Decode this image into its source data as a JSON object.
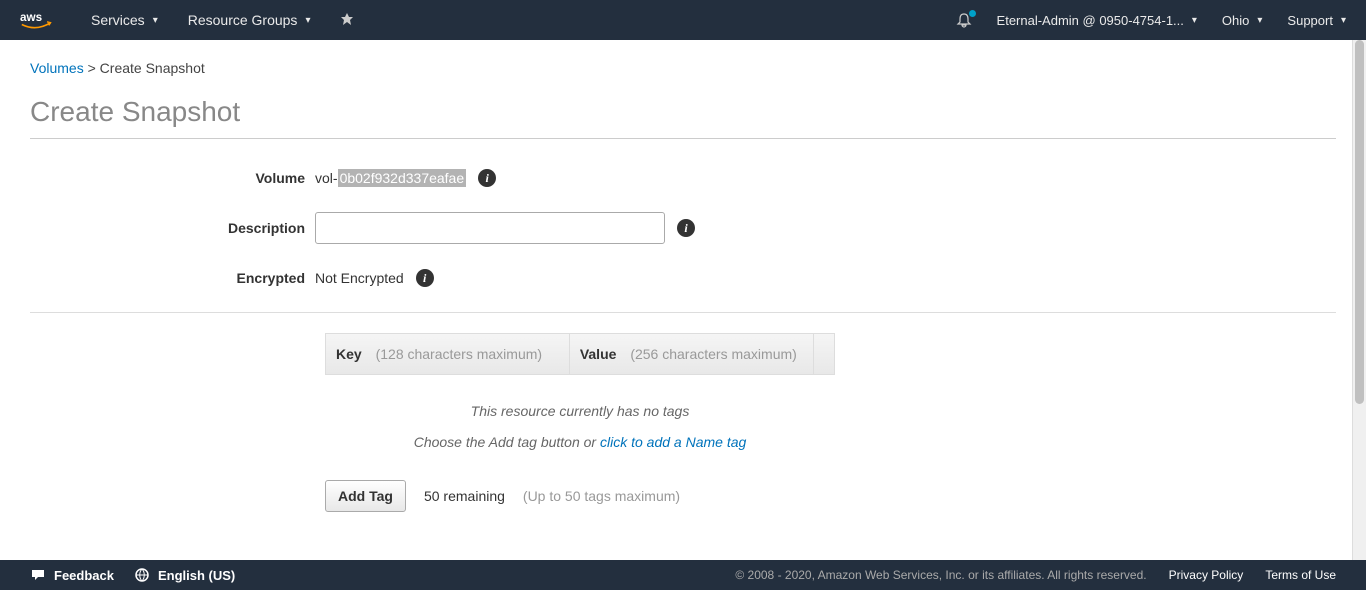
{
  "nav": {
    "services": "Services",
    "resource_groups": "Resource Groups",
    "account": "Eternal-Admin @ 0950-4754-1...",
    "region": "Ohio",
    "support": "Support"
  },
  "breadcrumb": {
    "parent": "Volumes",
    "sep": ">",
    "current": "Create Snapshot"
  },
  "page_title": "Create Snapshot",
  "form": {
    "volume_label": "Volume",
    "volume_prefix": "vol-",
    "volume_id": "0b02f932d337eafae",
    "description_label": "Description",
    "description_value": "",
    "encrypted_label": "Encrypted",
    "encrypted_value": "Not Encrypted"
  },
  "tags": {
    "key_label": "Key",
    "key_hint": "(128 characters maximum)",
    "value_label": "Value",
    "value_hint": "(256 characters maximum)",
    "empty_msg": "This resource currently has no tags",
    "choose_msg": "Choose the Add tag button or ",
    "click_link": "click to add a Name tag",
    "add_btn": "Add Tag",
    "remaining": "50 remaining",
    "max_hint": "(Up to 50 tags maximum)"
  },
  "footer": {
    "feedback": "Feedback",
    "language": "English (US)",
    "copyright": "© 2008 - 2020, Amazon Web Services, Inc. or its affiliates. All rights reserved.",
    "privacy": "Privacy Policy",
    "terms": "Terms of Use"
  }
}
